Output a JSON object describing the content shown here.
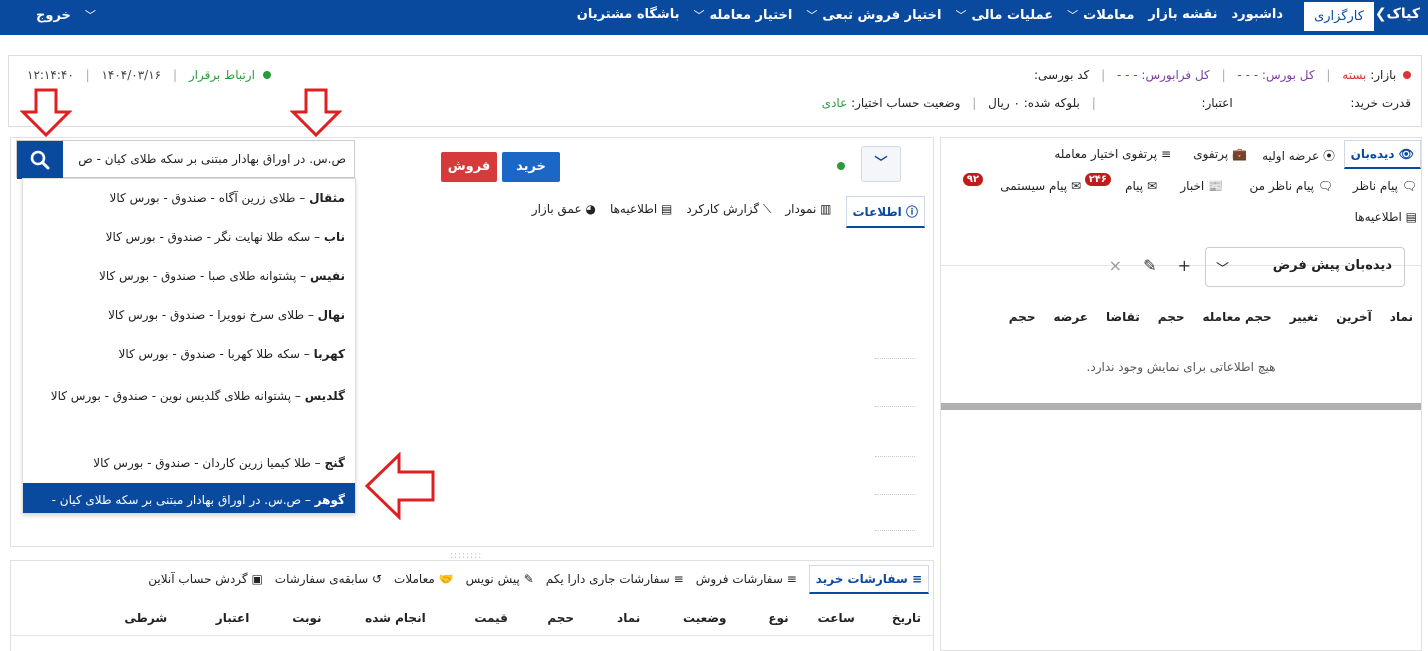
{
  "topbar": {
    "logo": "کیاک❯",
    "active_tab": "کارگزاری",
    "nav": [
      "داشبورد",
      "نقشه بازار",
      "معاملات",
      "عملیات مالی",
      "اختیار فروش تبعی",
      "اختیار معامله",
      "باشگاه مشتریان"
    ],
    "exit": "خروج"
  },
  "status": {
    "market_label": "بازار:",
    "market_value": "بسته",
    "total_bourse_label": "کل بورس:",
    "total_bourse_value": "- - -",
    "total_farabourse_label": "کل فرابورس:",
    "total_farabourse_value": "- - -",
    "bourse_code_label": "کد بورسی:",
    "connection": "ارتباط برقرار",
    "date": "۱۴۰۴/۰۳/۱۶",
    "time": "۱۲:۱۴:۴۰",
    "buying_power_label": "قدرت خرید:",
    "credit_label": "اعتبار:",
    "blocked_label": "بلوکه شده: ۰ ریال",
    "option_status_label": "وضعیت حساب اختیار:",
    "option_status_value": "عادی"
  },
  "right_panel": {
    "tabs": {
      "watchlist": "دیدەبان",
      "ipo": "عرضه اولیه",
      "portfolio": "پرتفوی",
      "option_portfolio": "پرتفوی اختیار معامله",
      "messages": "پیام",
      "news": "اخبار",
      "observer_messages": "پیام ناظر من",
      "observer": "پیام ناظر",
      "system_messages": "پیام سیستمی",
      "announcements": "اطلاعیه‌ها",
      "messages_badge": "۲۴۶",
      "system_badge": "۹۲"
    },
    "watchlist_select": "دیدەبان پیش فرض",
    "columns": [
      "نماد",
      "آخرین",
      "تغییر",
      "حجم معامله",
      "حجم",
      "تقاضا",
      "عرضه",
      "حجم"
    ],
    "empty": "هیچ اطلاعاتی برای نمایش وجود ندارد."
  },
  "middle": {
    "buy": "خرید",
    "sell": "فروش",
    "tabs": [
      "اطلاعات",
      "نمودار",
      "گزارش کارکرد",
      "اطلاعیه‌ها",
      "عمق بازار"
    ]
  },
  "search": {
    "value": "ص.س. در اوراق بهادار مبتنی بر سکه طلای کیان - ص"
  },
  "dropdown": [
    {
      "symbol": "مثقال",
      "desc": " – طلای زرین آگاه - صندوق - بورس کالا"
    },
    {
      "symbol": "ناب",
      "desc": " – سکه طلا نهایت نگر - صندوق - بورس کالا"
    },
    {
      "symbol": "نفیس",
      "desc": " – پشتوانه طلای صبا - صندوق - بورس کالا"
    },
    {
      "symbol": "نهال",
      "desc": " – طلای سرخ نوویرا - صندوق - بورس کالا"
    },
    {
      "symbol": "کهربا",
      "desc": " – سکه طلا کهربا - صندوق - بورس کالا"
    },
    {
      "symbol": "گلدیس",
      "desc": " – پشتوانه طلای گلدیس نوین - صندوق - بورس کالا"
    },
    {
      "symbol": "گنج",
      "desc": " – طلا کیمیا زرین کاردان - صندوق - بورس کالا"
    },
    {
      "symbol": "گوهر",
      "desc": " – ص.س. در اوراق بهادار مبتنی بر سکه طلای کیان - صندوق - بورس کالا"
    }
  ],
  "bottom": {
    "tabs": [
      "سفارشات خرید",
      "سفارشات فروش",
      "سفارشات جاری دارا یکم",
      "پیش نویس",
      "معاملات",
      "سابقه‌ی سفارشات",
      "گردش حساب آنلاین"
    ],
    "columns": [
      "تاریخ",
      "ساعت",
      "نوع",
      "وضعیت",
      "نماد",
      "حجم",
      "قیمت",
      "انجام شده",
      "نوبت",
      "اعتبار",
      "شرطی"
    ]
  },
  "colors": {
    "primary": "#0a4a9e",
    "buy": "#1a67c6",
    "sell": "#d63a3a",
    "arrow": "#e02020"
  }
}
